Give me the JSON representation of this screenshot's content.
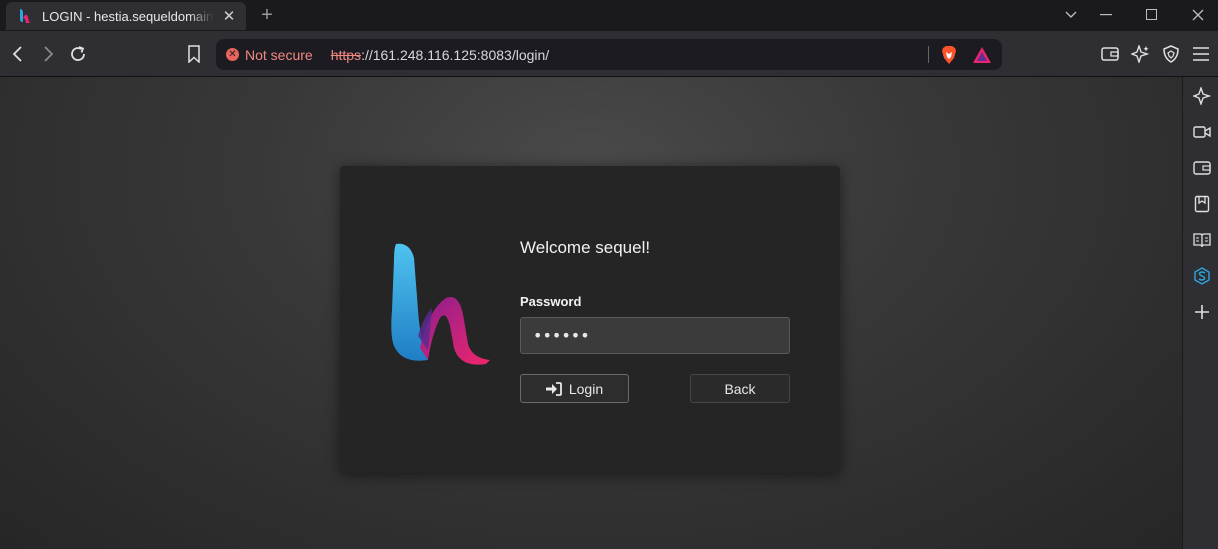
{
  "browser": {
    "tab_title": "LOGIN - hestia.sequeldomain.my",
    "security_label": "Not secure",
    "url_scheme": "https",
    "url_rest": "://161.248.116.125:8083/login/"
  },
  "login": {
    "welcome": "Welcome sequel!",
    "password_label": "Password",
    "password_value": "••••••",
    "login_button": "Login",
    "back_button": "Back"
  },
  "colors": {
    "insecure": "#f08a80",
    "logo_blue": "#2aa8e0",
    "logo_pink": "#e8256f"
  },
  "icons": {
    "tab": [
      "hestia-favicon",
      "close-icon",
      "plus-icon"
    ],
    "window": [
      "chevron-down-icon",
      "minimize-icon",
      "maximize-icon",
      "close-icon"
    ],
    "toolbar": [
      "back-icon",
      "forward-icon",
      "reload-icon",
      "bookmark-icon",
      "wallet-icon",
      "leo-ai-icon",
      "brave-shield-icon",
      "menu-icon"
    ],
    "sidebar": [
      "leo-ai-icon",
      "video-call-icon",
      "wallet-icon",
      "bookmarks-icon",
      "reading-list-icon",
      "sequel-icon",
      "add-icon"
    ]
  }
}
